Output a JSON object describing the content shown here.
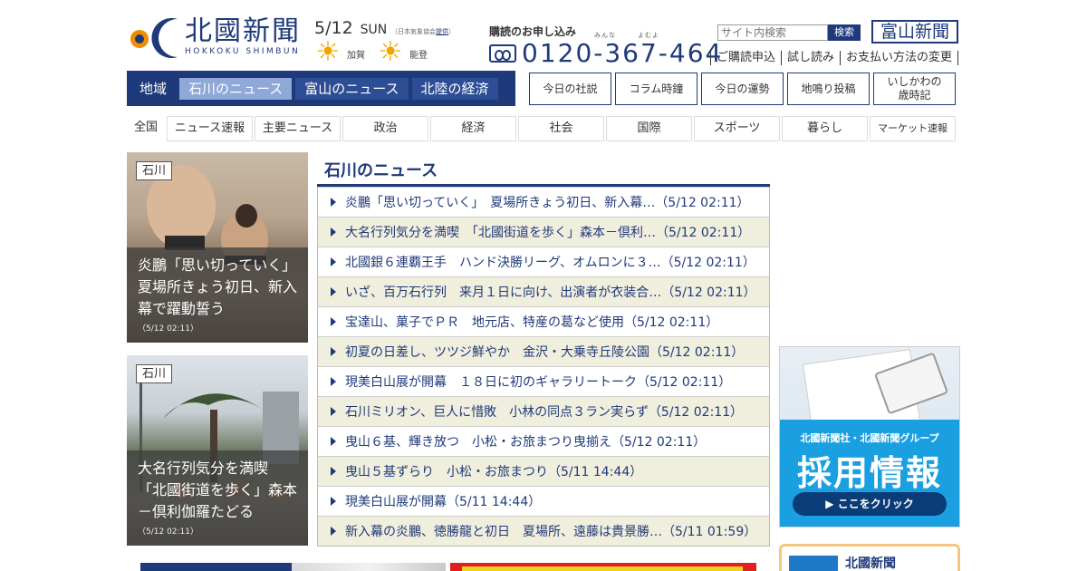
{
  "header": {
    "logo_name": "北國新聞",
    "logo_sub": "HOKKOKU SHIMBUN",
    "date": "5/12",
    "day": "SUN",
    "weather_source": "（日本気象協会",
    "weather_source_link": "提供",
    "weather_source_end": "）",
    "weather": [
      {
        "area": "加賀",
        "icon": "sun-icon"
      },
      {
        "area": "能登",
        "icon": "sun-icon"
      }
    ],
    "subscribe_title": "購読のお申し込み",
    "furigana": "みんな　　　よむよ",
    "phone": "0120-367-464",
    "search_placeholder": "サイト内検索",
    "search_button": "検索",
    "toyama_button": "富山新聞",
    "links": [
      "ご購読申込",
      "試し読み",
      "お支払い方法の変更"
    ]
  },
  "region_nav": {
    "label": "地域",
    "items": [
      "石川のニュース",
      "富山のニュース",
      "北陸の経済"
    ],
    "active_index": 0
  },
  "features": [
    "今日の社説",
    "コラム時鐘",
    "今日の運勢",
    "地鳴り投稿",
    "いしかわの歳時記"
  ],
  "categories": [
    "全国",
    "ニュース速報",
    "主要ニュース",
    "政治",
    "経済",
    "社会",
    "国際",
    "スポーツ",
    "暮らし",
    "マーケット速報"
  ],
  "photo_cards": [
    {
      "tag": "石川",
      "title": "炎鵬「思い切っていく」　夏場所きょう初日、新入幕で躍動誓う",
      "time": "（5/12 02:11）"
    },
    {
      "tag": "石川",
      "title": "大名行列気分を満喫　「北國街道を歩く」森本－倶利伽羅たどる",
      "time": "（5/12 02:11）"
    }
  ],
  "news": {
    "heading": "石川のニュース",
    "items": [
      "炎鵬「思い切っていく」　夏場所きょう初日、新入幕…（5/12 02:11）",
      "大名行列気分を満喫　「北國街道を歩く」森本－倶利…（5/12 02:11）",
      "北國銀６連覇王手　ハンド決勝リーグ、オムロンに３…（5/12 02:11）",
      "いざ、百万石行列　来月１日に向け、出演者が衣装合…（5/12 02:11）",
      "宝達山、菓子でＰＲ　地元店、特産の葛など使用（5/12 02:11）",
      "初夏の日差し、ツツジ鮮やか　金沢・大乗寺丘陵公園（5/12 02:11）",
      "現美白山展が開幕　１８日に初のギャラリートーク（5/12 02:11）",
      "石川ミリオン、巨人に惜敗　小林の同点３ラン実らず（5/12 02:11）",
      "曳山６基、輝き放つ　小松・お旅まつり曳揃え（5/12 02:11）",
      "曳山５基ずらり　小松・お旅まつり（5/11 14:44）",
      "現美白山展が開幕（5/11 14:44）",
      "新入幕の炎鵬、徳勝龍と初日　夏場所、遠藤は貴景勝…（5/11 01:59）"
    ]
  },
  "banner": {
    "small": "北國新聞社・北國新聞グループ",
    "big": "採用情報",
    "click": "▶ ここをクリック"
  },
  "mini_card": {
    "name": "北國新聞"
  }
}
